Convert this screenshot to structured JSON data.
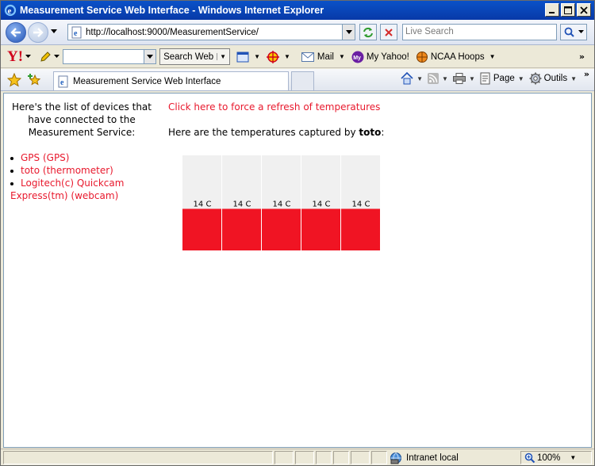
{
  "window": {
    "title": "Measurement Service Web Interface - Windows Internet Explorer"
  },
  "address_bar": {
    "url": "http://localhost:9000/MeasurementService/",
    "search_placeholder": "Live Search"
  },
  "yahoo_toolbar": {
    "logo": "Y!",
    "search_button": "Search Web",
    "mail": "Mail",
    "my_yahoo": "My Yahoo!",
    "ncaa": "NCAA Hoops"
  },
  "tab": {
    "label": "Measurement Service Web Interface"
  },
  "command_bar": {
    "page": "Page",
    "tools": "Outils"
  },
  "content": {
    "devices_heading": "Here's the list of devices that have connected to the Measurement Service:",
    "devices": [
      "GPS (GPS)",
      "toto (thermometer)",
      "Logitech(c) Quickcam Express(tm) (webcam)"
    ],
    "refresh_link": "Click here to force a refresh of temperatures",
    "temps_heading_prefix": "Here are the temperatures captured by ",
    "temps_device": "toto",
    "temps_heading_suffix": ":"
  },
  "chart_data": {
    "type": "bar",
    "categories": [
      "",
      "",
      "",
      "",
      ""
    ],
    "values": [
      14,
      14,
      14,
      14,
      14
    ],
    "value_labels": [
      "14 C",
      "14 C",
      "14 C",
      "14 C",
      "14 C"
    ],
    "ylim": [
      0,
      32
    ],
    "bar_color": "#f01423",
    "background_color": "#f0f0f0"
  },
  "status_bar": {
    "zone": "Intranet local",
    "zoom": "100%"
  }
}
